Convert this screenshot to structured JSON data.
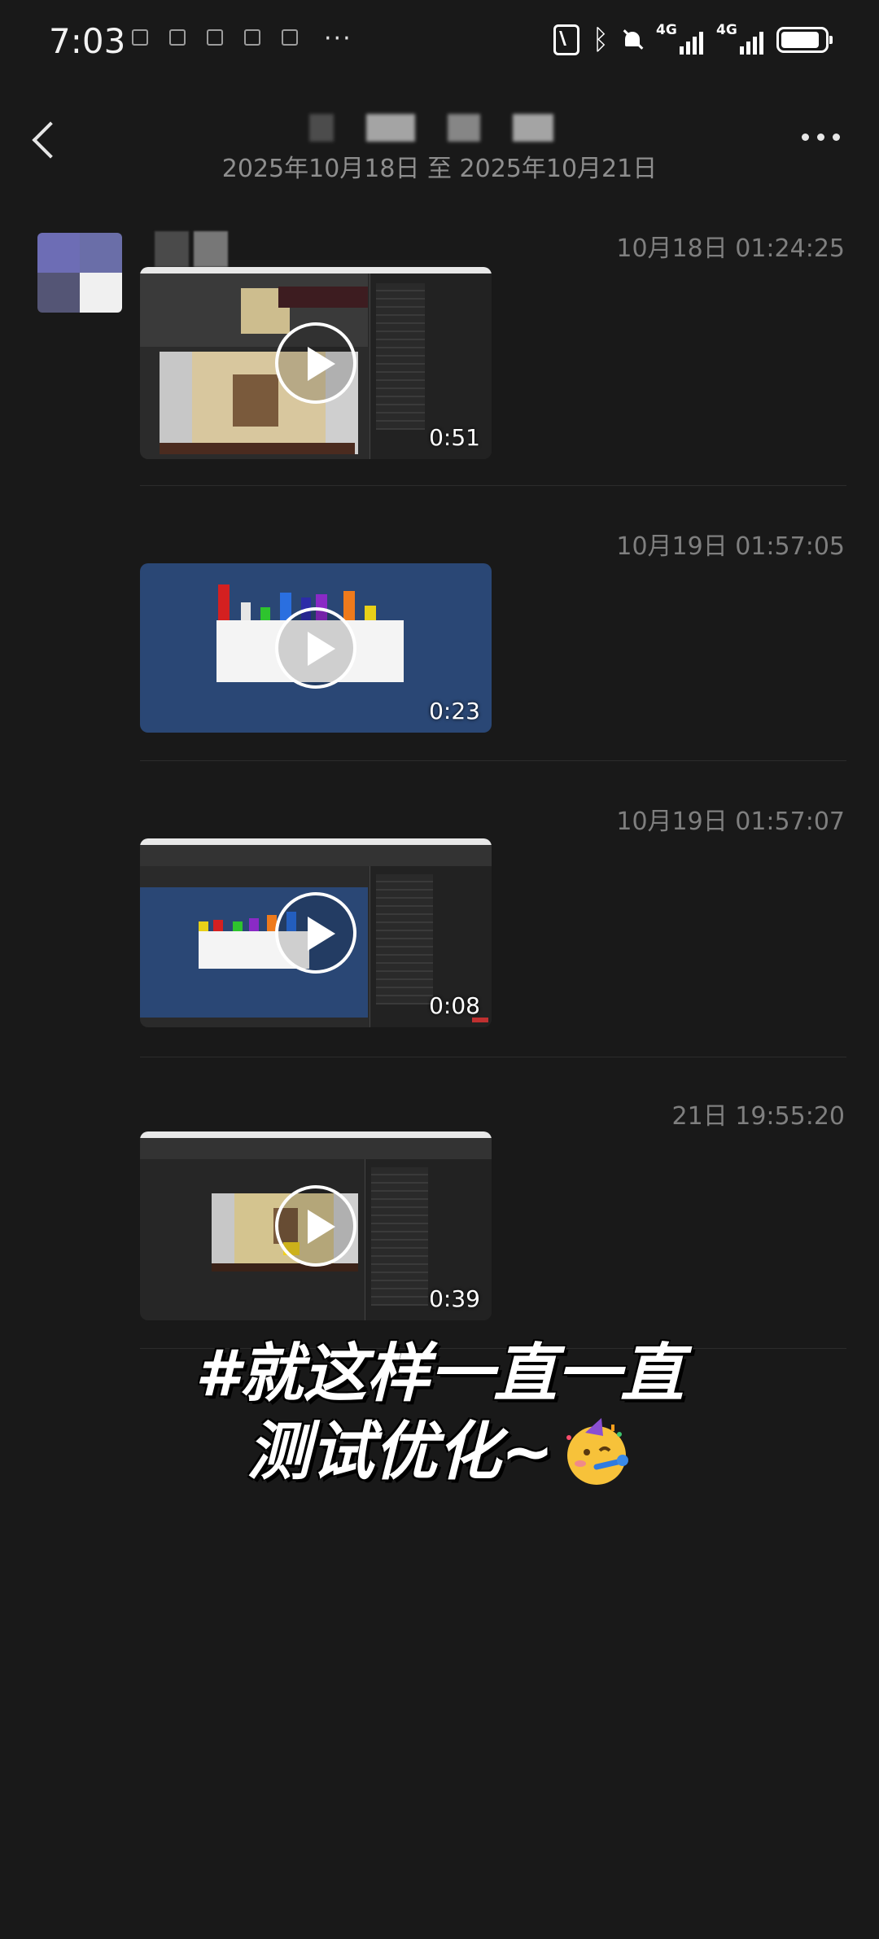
{
  "status_bar": {
    "time": "7:03",
    "more": "···",
    "network_1": "4G",
    "network_2": "4G",
    "battery_percent": 90
  },
  "header": {
    "date_range": "2025年10月18日 至 2025年10月21日"
  },
  "messages": [
    {
      "timestamp": "10月18日 01:24:25",
      "duration": "0:51"
    },
    {
      "timestamp": "10月19日 01:57:05",
      "duration": "0:23"
    },
    {
      "timestamp": "10月19日 01:57:07",
      "duration": "0:08"
    },
    {
      "timestamp": "21日 19:55:20",
      "duration": "0:39"
    }
  ],
  "caption": {
    "line1": "#就这样一直一直",
    "line2": "测试优化~"
  },
  "icons": {
    "back": "back-arrow-icon",
    "menu": "more-options-icon",
    "play": "play-icon",
    "emoji": "partying-face-emoji"
  }
}
